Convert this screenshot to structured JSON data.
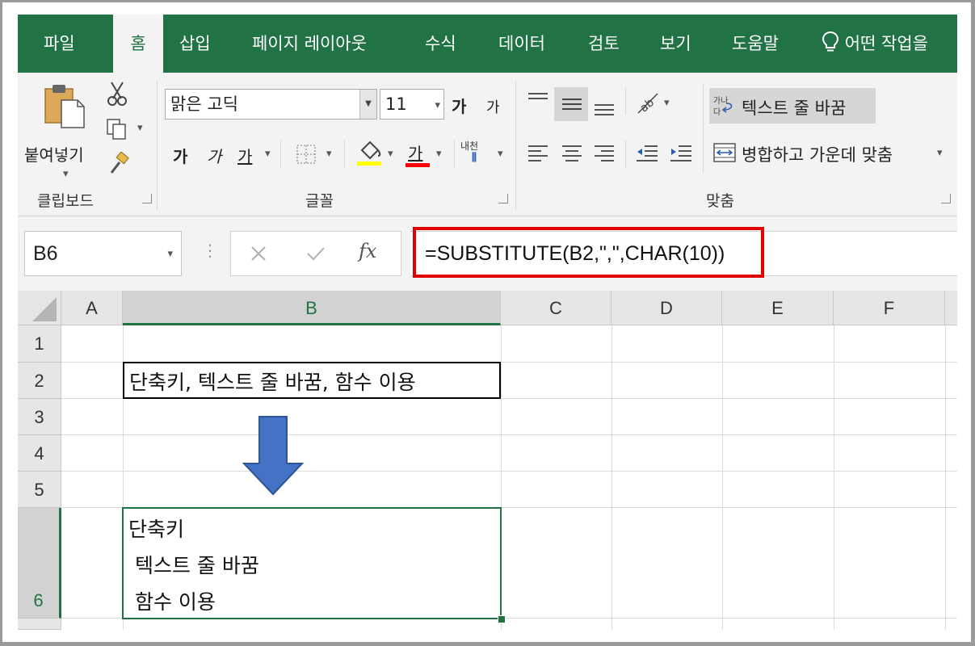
{
  "ribbon": {
    "tabs": [
      "파일",
      "홈",
      "삽입",
      "페이지 레이아웃",
      "수식",
      "데이터",
      "검토",
      "보기",
      "도움말"
    ],
    "tell_me": "어떤 작업을",
    "clipboard": {
      "paste_label": "붙여넣기",
      "group_label": "클립보드"
    },
    "font": {
      "name": "맑은 고딕",
      "size": "11",
      "grow_label": "가",
      "shrink_label": "가",
      "bold_label": "가",
      "italic_label": "가",
      "underline_label": "가",
      "font_color_label": "가",
      "phonetic_label": "내천",
      "group_label": "글꼴",
      "fill_color": "#ffff00",
      "text_color": "#ff0000"
    },
    "alignment": {
      "wrap_text": "텍스트 줄 바꿈",
      "merge_center": "병합하고 가운데 맞춤",
      "group_label": "맞춤"
    }
  },
  "formula_bar": {
    "name_box": "B6",
    "fx_label": "fx",
    "formula": "=SUBSTITUTE(B2,\",\",CHAR(10))"
  },
  "sheet": {
    "columns": [
      "A",
      "B",
      "C",
      "D",
      "E",
      "F"
    ],
    "rows": [
      "1",
      "2",
      "3",
      "4",
      "5",
      "6"
    ],
    "b2": "단축키, 텍스트 줄 바꿈, 함수 이용",
    "b6_lines": [
      "단축키",
      " 텍스트 줄 바꿈",
      " 함수 이용"
    ],
    "accent_color": "#217346",
    "arrow_color": "#4472c4"
  }
}
